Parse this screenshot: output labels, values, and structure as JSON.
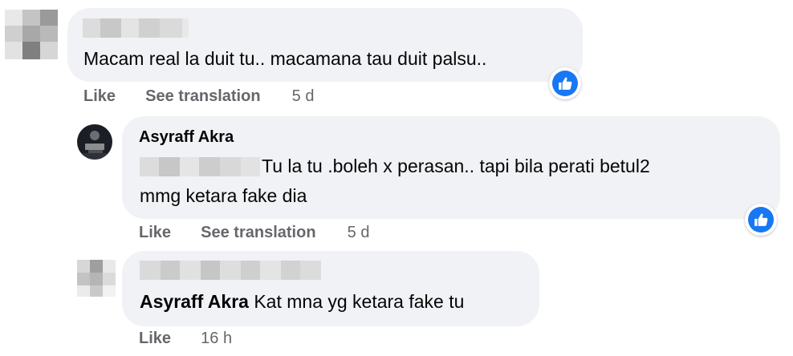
{
  "comments": [
    {
      "text": "Macam real la duit tu.. macamana tau duit palsu..",
      "actions": {
        "like": "Like",
        "translate": "See translation",
        "time": "5 d"
      },
      "reaction_icon": "thumbs-up-icon"
    },
    {
      "author": "Asyraff Akra",
      "text_line1": "Tu la tu .boleh x perasan.. tapi bila perati betul2",
      "text_line2": "mmg ketara fake dia",
      "actions": {
        "like": "Like",
        "translate": "See translation",
        "time": "5 d"
      },
      "reaction_icon": "thumbs-up-icon"
    },
    {
      "tag": "Asyraff Akra",
      "text": " Kat mna yg ketara fake tu",
      "actions": {
        "like": "Like",
        "time": "16 h"
      }
    }
  ],
  "colors": {
    "bubble": "#f0f2f5",
    "secondary_text": "#65676b",
    "reaction_blue": "#1877f2"
  }
}
